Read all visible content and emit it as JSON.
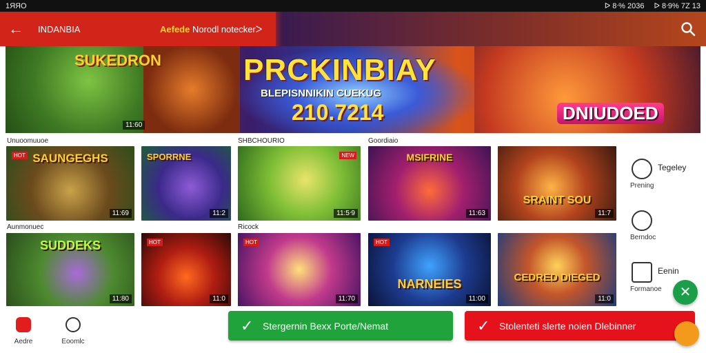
{
  "status_bar": {
    "left_text": "1ЯЯО",
    "right_group_1": "ᐅ 8ᐧ% 2036",
    "right_group_2": "ᐅ 8ᐧ9% 7Ζ 13"
  },
  "app_bar": {
    "back_glyph": "←",
    "region_label": "INDANBIA",
    "promo_label_a": "Aefede",
    "promo_label_b": "Norodl noteckerᐳ"
  },
  "hero": {
    "title": "PRCKINBIAY",
    "subtitle": "BLEPISNNIKIN CUEKUG",
    "date": "210.7214",
    "left_title": "SUKEDRON",
    "right_badge": "DNIUDOED",
    "left_count": "11:60"
  },
  "section_labels": {
    "row1_a": "Unuoomuuoe",
    "row1_b": "SHBCHOURIO",
    "row1_c": "Goordiaio",
    "row2_a": "Aunmonuec",
    "row2_b": "Ricock"
  },
  "cards_row1": [
    {
      "title": "SAUNGEGHS",
      "count": "11:69"
    },
    {
      "title": "SPORRNE",
      "count": "11:2"
    },
    {
      "title": "",
      "count": "11:5ᐧ9"
    },
    {
      "title": "MSIFRINE",
      "count": "11:63"
    },
    {
      "title": "SRAINT SOU",
      "count": "11:7"
    }
  ],
  "cards_row2": [
    {
      "title": "SUDDEKS",
      "count": "11:80"
    },
    {
      "title": "",
      "count": "11:0"
    },
    {
      "title": "",
      "count": "11:70"
    },
    {
      "title": "NARNEIES",
      "count": "11:00"
    },
    {
      "title": "CEDRED DIEGED",
      "count": "11:0"
    }
  ],
  "sidebar": {
    "item1_title": "Tegeley",
    "item1_sub": "Prening",
    "item2_sub": "Berndoc",
    "item3_title": "Eenin",
    "item3_sub": "Formanoe"
  },
  "bottom_nav": {
    "item1": "Aedre",
    "item2": "Eoomlc"
  },
  "buttons": {
    "green_label": "Stergernin Bexx Porte/Nemat",
    "red_label": "Stolenteti slerte noien Dlebinner"
  },
  "colors": {
    "green": "#1fa33a",
    "red": "#e5121b",
    "fab_green": "#1a9e48",
    "fab_orange": "#f39a1c"
  }
}
